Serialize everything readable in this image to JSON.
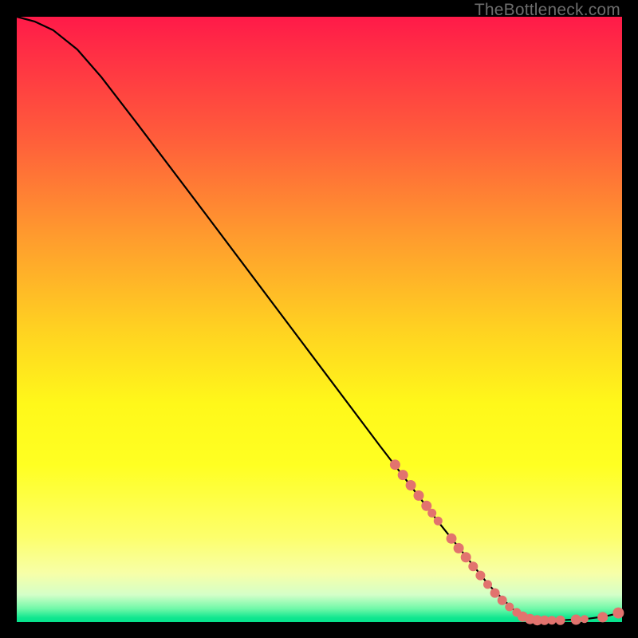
{
  "watermark": "TheBottleneck.com",
  "chart_data": {
    "type": "line",
    "title": "",
    "xlabel": "",
    "ylabel": "",
    "xlim": [
      0,
      100
    ],
    "ylim": [
      0,
      100
    ],
    "curve": [
      {
        "x": 0,
        "y": 100
      },
      {
        "x": 3,
        "y": 99.2
      },
      {
        "x": 6,
        "y": 97.8
      },
      {
        "x": 10,
        "y": 94.6
      },
      {
        "x": 14,
        "y": 90.0
      },
      {
        "x": 20,
        "y": 82.2
      },
      {
        "x": 30,
        "y": 69.0
      },
      {
        "x": 40,
        "y": 55.7
      },
      {
        "x": 50,
        "y": 42.4
      },
      {
        "x": 60,
        "y": 29.1
      },
      {
        "x": 70,
        "y": 16.1
      },
      {
        "x": 78,
        "y": 6.1
      },
      {
        "x": 82,
        "y": 2.1
      },
      {
        "x": 84,
        "y": 0.8
      },
      {
        "x": 86,
        "y": 0.3
      },
      {
        "x": 90,
        "y": 0.3
      },
      {
        "x": 94,
        "y": 0.5
      },
      {
        "x": 97,
        "y": 0.9
      },
      {
        "x": 100,
        "y": 1.6
      }
    ],
    "points": [
      {
        "x": 62.5,
        "y": 26.0,
        "r": 6.5
      },
      {
        "x": 63.8,
        "y": 24.3,
        "r": 6.5
      },
      {
        "x": 65.1,
        "y": 22.6,
        "r": 6.5
      },
      {
        "x": 66.4,
        "y": 20.9,
        "r": 6.5
      },
      {
        "x": 67.7,
        "y": 19.2,
        "r": 6.5
      },
      {
        "x": 68.6,
        "y": 18.0,
        "r": 5.5
      },
      {
        "x": 69.6,
        "y": 16.7,
        "r": 5.5
      },
      {
        "x": 71.8,
        "y": 13.8,
        "r": 6.5
      },
      {
        "x": 73.0,
        "y": 12.2,
        "r": 6.5
      },
      {
        "x": 74.2,
        "y": 10.7,
        "r": 6.5
      },
      {
        "x": 75.4,
        "y": 9.2,
        "r": 6.0
      },
      {
        "x": 76.6,
        "y": 7.7,
        "r": 6.0
      },
      {
        "x": 77.8,
        "y": 6.2,
        "r": 5.5
      },
      {
        "x": 79.0,
        "y": 4.8,
        "r": 6.0
      },
      {
        "x": 80.2,
        "y": 3.6,
        "r": 6.0
      },
      {
        "x": 81.4,
        "y": 2.5,
        "r": 5.5
      },
      {
        "x": 82.6,
        "y": 1.6,
        "r": 5.5
      },
      {
        "x": 83.6,
        "y": 0.9,
        "r": 6.5
      },
      {
        "x": 84.8,
        "y": 0.5,
        "r": 6.5
      },
      {
        "x": 86.0,
        "y": 0.3,
        "r": 6.5
      },
      {
        "x": 87.2,
        "y": 0.3,
        "r": 6.0
      },
      {
        "x": 88.4,
        "y": 0.3,
        "r": 5.5
      },
      {
        "x": 89.8,
        "y": 0.3,
        "r": 6.0
      },
      {
        "x": 92.4,
        "y": 0.4,
        "r": 6.5
      },
      {
        "x": 93.8,
        "y": 0.5,
        "r": 5.0
      },
      {
        "x": 96.8,
        "y": 0.8,
        "r": 6.5
      },
      {
        "x": 99.4,
        "y": 1.5,
        "r": 7.0
      }
    ]
  }
}
